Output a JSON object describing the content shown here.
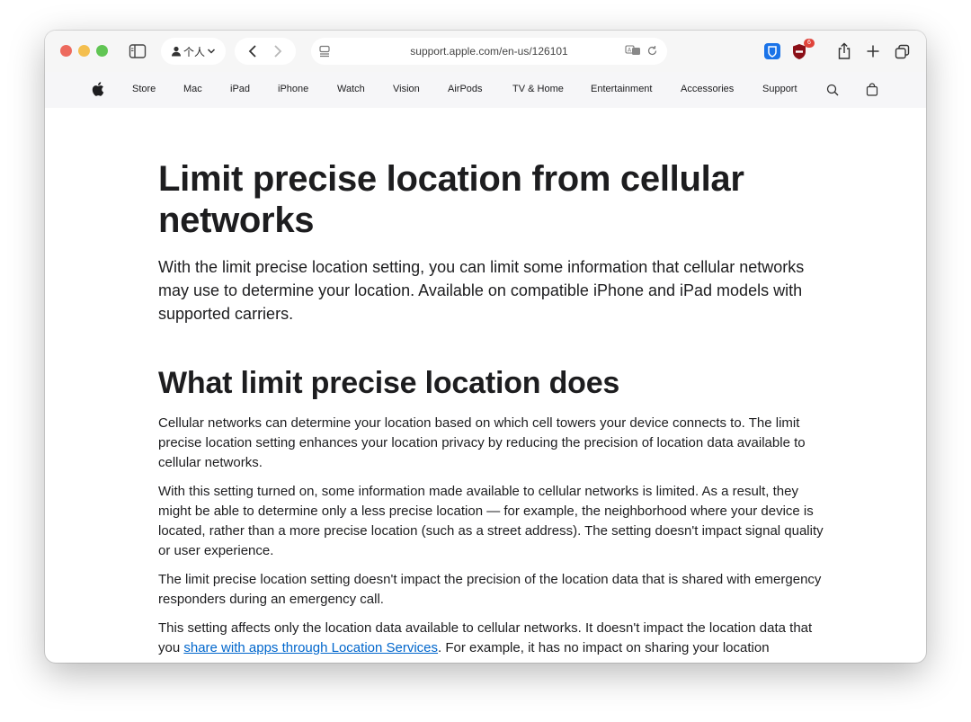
{
  "browser": {
    "profile_label": "个人",
    "url": "support.apple.com/en-us/126101",
    "extension_badge": "6"
  },
  "globalnav": {
    "items": [
      "Store",
      "Mac",
      "iPad",
      "iPhone",
      "Watch",
      "Vision",
      "AirPods",
      "TV & Home",
      "Entertainment",
      "Accessories",
      "Support"
    ]
  },
  "article": {
    "title": "Limit precise location from cellular networks",
    "intro": "With the limit precise location setting, you can limit some information that cellular networks may use to determine your location. Available on compatible iPhone and iPad models with supported carriers.",
    "section_heading": "What limit precise location does",
    "p1": "Cellular networks can determine your location based on which cell towers your device connects to. The limit precise location setting enhances your location privacy by reducing the precision of location data available to cellular networks.",
    "p2": "With this setting turned on, some information made available to cellular networks is limited. As a result, they might be able to determine only a less precise location — for example, the neighborhood where your device is located, rather than a more precise location (such as a street address). The setting doesn't impact signal quality or user experience.",
    "p3": "The limit precise location setting doesn't impact the precision of the location data that is shared with emergency responders during an emergency call.",
    "p4_before": "This setting affects only the location data available to cellular networks. It doesn't impact the location data that you ",
    "p4_link": "share with apps through Location Services",
    "p4_after": ". For example, it has no impact on sharing your location"
  }
}
